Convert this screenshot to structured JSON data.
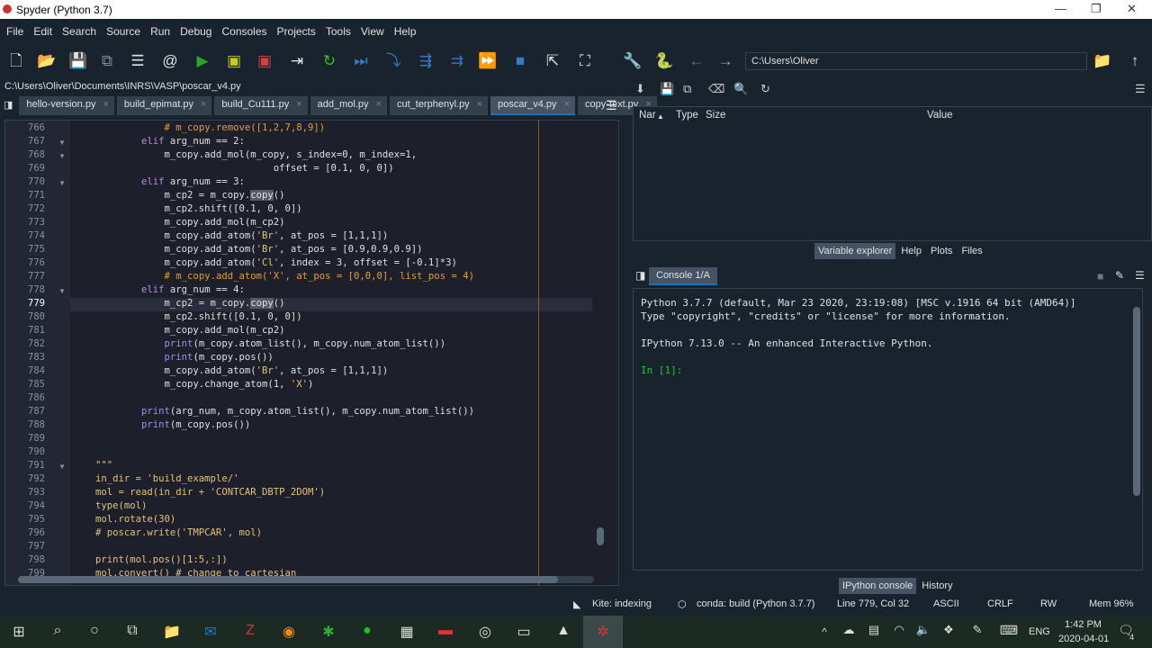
{
  "window": {
    "title": "Spyder (Python 3.7)",
    "controls": [
      "—",
      "❐",
      "✕"
    ]
  },
  "menu": [
    "File",
    "Edit",
    "Search",
    "Source",
    "Run",
    "Debug",
    "Consoles",
    "Projects",
    "Tools",
    "View",
    "Help"
  ],
  "toolbar": {
    "cwd": "C:\\Users\\Oliver"
  },
  "editor": {
    "path": "C:\\Users\\Oliver\\Documents\\INRS\\VASP\\poscar_v4.py",
    "tabs": [
      {
        "label": "hello-version.py"
      },
      {
        "label": "build_epimat.py"
      },
      {
        "label": "build_Cu111.py"
      },
      {
        "label": "add_mol.py"
      },
      {
        "label": "cut_terphenyl.py"
      },
      {
        "label": "poscar_v4.py",
        "active": true
      },
      {
        "label": "copy-text.py"
      }
    ],
    "current_line": 779,
    "lines": [
      {
        "n": "766",
        "tok": [
          [
            "            ",
            ""
          ],
          [
            "# m_copy.remove([1,2,7,8,9])",
            "cm"
          ]
        ]
      },
      {
        "n": "767",
        "fold": true,
        "tok": [
          [
            "        ",
            ""
          ],
          [
            "elif",
            "kw"
          ],
          [
            " arg_num == 2:",
            ""
          ]
        ]
      },
      {
        "n": "768",
        "fold": true,
        "tok": [
          [
            "            m_copy.add_mol(m_copy, s_index=0, m_index=1,",
            ""
          ]
        ]
      },
      {
        "n": "769",
        "tok": [
          [
            "                               offset = [0.1, 0, 0])",
            ""
          ]
        ]
      },
      {
        "n": "770",
        "fold": true,
        "tok": [
          [
            "        ",
            ""
          ],
          [
            "elif",
            "kw"
          ],
          [
            " arg_num == 3:",
            ""
          ]
        ]
      },
      {
        "n": "771",
        "tok": [
          [
            "            m_cp2 = m_copy.",
            ""
          ],
          [
            "copy",
            "hl"
          ],
          [
            "()",
            ""
          ]
        ]
      },
      {
        "n": "772",
        "tok": [
          [
            "            m_cp2.shift([0.1, 0, 0])",
            ""
          ]
        ]
      },
      {
        "n": "773",
        "tok": [
          [
            "            m_copy.add_mol(m_cp2)",
            ""
          ]
        ]
      },
      {
        "n": "774",
        "tok": [
          [
            "            m_copy.add_atom(",
            ""
          ],
          [
            "'Br'",
            "st"
          ],
          [
            ", at_pos = [1,1,1])",
            ""
          ]
        ]
      },
      {
        "n": "775",
        "tok": [
          [
            "            m_copy.add_atom(",
            ""
          ],
          [
            "'Br'",
            "st"
          ],
          [
            ", at_pos = [0.9,0.9,0.9])",
            ""
          ]
        ]
      },
      {
        "n": "776",
        "tok": [
          [
            "            m_copy.add_atom(",
            ""
          ],
          [
            "'Cl'",
            "st"
          ],
          [
            ", index = 3, offset = [-0.1]*3)",
            ""
          ]
        ]
      },
      {
        "n": "777",
        "tok": [
          [
            "            ",
            ""
          ],
          [
            "# m_copy.add_atom('X', at_pos = [0,0,0], list_pos = 4)",
            "cm"
          ]
        ]
      },
      {
        "n": "778",
        "fold": true,
        "tok": [
          [
            "        ",
            ""
          ],
          [
            "elif",
            "kw"
          ],
          [
            " arg_num == 4:",
            ""
          ]
        ]
      },
      {
        "n": "779",
        "tok": [
          [
            "            m_cp2 = m_copy.",
            ""
          ],
          [
            "copy",
            "hl"
          ],
          [
            "()",
            ""
          ]
        ]
      },
      {
        "n": "780",
        "tok": [
          [
            "            m_cp2.shift([0.1, 0, 0])",
            ""
          ]
        ]
      },
      {
        "n": "781",
        "tok": [
          [
            "            m_copy.add_mol(m_cp2)",
            ""
          ]
        ]
      },
      {
        "n": "782",
        "tok": [
          [
            "            ",
            ""
          ],
          [
            "print",
            "bi"
          ],
          [
            "(m_copy.atom_list(), m_copy.num_atom_list())",
            ""
          ]
        ]
      },
      {
        "n": "783",
        "tok": [
          [
            "            ",
            ""
          ],
          [
            "print",
            "bi"
          ],
          [
            "(m_copy.pos())",
            ""
          ]
        ]
      },
      {
        "n": "784",
        "tok": [
          [
            "            m_copy.add_atom(",
            ""
          ],
          [
            "'Br'",
            "st"
          ],
          [
            ", at_pos = [1,1,1])",
            ""
          ]
        ]
      },
      {
        "n": "785",
        "tok": [
          [
            "            m_copy.change_atom(1, ",
            ""
          ],
          [
            "'X'",
            "st"
          ],
          [
            ")",
            ""
          ]
        ]
      },
      {
        "n": "786",
        "tok": []
      },
      {
        "n": "787",
        "tok": [
          [
            "        ",
            ""
          ],
          [
            "print",
            "bi"
          ],
          [
            "(arg_num, m_copy.atom_list(), m_copy.num_atom_list())",
            ""
          ]
        ]
      },
      {
        "n": "788",
        "tok": [
          [
            "        ",
            ""
          ],
          [
            "print",
            "bi"
          ],
          [
            "(m_copy.pos())",
            ""
          ]
        ]
      },
      {
        "n": "789",
        "tok": []
      },
      {
        "n": "790",
        "tok": []
      },
      {
        "n": "791",
        "fold": true,
        "tok": [
          [
            "\"\"\"",
            "st"
          ]
        ]
      },
      {
        "n": "792",
        "tok": [
          [
            "in_dir = 'build_example/'",
            "st"
          ]
        ]
      },
      {
        "n": "793",
        "tok": [
          [
            "mol = read(in_dir + 'CONTCAR_DBTP_2DOM')",
            "st"
          ]
        ]
      },
      {
        "n": "794",
        "tok": [
          [
            "type(mol)",
            "st"
          ]
        ]
      },
      {
        "n": "795",
        "tok": [
          [
            "mol.rotate(30)",
            "st"
          ]
        ]
      },
      {
        "n": "796",
        "tok": [
          [
            "# poscar.write('TMPCAR', mol)",
            "st"
          ]
        ]
      },
      {
        "n": "797",
        "tok": []
      },
      {
        "n": "798",
        "tok": [
          [
            "print(mol.pos()[1:5,:])",
            "st"
          ]
        ]
      },
      {
        "n": "799",
        "tok": [
          [
            "mol.convert() # change to cartesian",
            "st"
          ]
        ]
      }
    ]
  },
  "variable_explorer": {
    "columns": [
      "Nar",
      "Type",
      "Size",
      "Value"
    ]
  },
  "top_pane_tabs": [
    {
      "label": "Variable explorer",
      "active": true
    },
    {
      "label": "Help"
    },
    {
      "label": "Plots"
    },
    {
      "label": "Files"
    }
  ],
  "console": {
    "tab": "Console 1/A",
    "lines": [
      "Python 3.7.7 (default, Mar 23 2020, 23:19:08) [MSC v.1916 64 bit (AMD64)]",
      "Type \"copyright\", \"credits\" or \"license\" for more information.",
      "",
      "IPython 7.13.0 -- An enhanced Interactive Python.",
      ""
    ],
    "prompt": "In [1]:"
  },
  "bottom_pane_tabs": [
    {
      "label": "IPython console",
      "active": true
    },
    {
      "label": "History"
    }
  ],
  "status": {
    "kite": "Kite: indexing",
    "conda": "conda: build (Python 3.7.7)",
    "position": "Line 779, Col 32",
    "encoding": "ASCII",
    "eol": "CRLF",
    "perm": "RW",
    "mem": "Mem 96%"
  },
  "taskbar": {
    "time": "1:42 PM",
    "date": "2020-04-01",
    "lang": "ENG",
    "notifications": "4"
  }
}
